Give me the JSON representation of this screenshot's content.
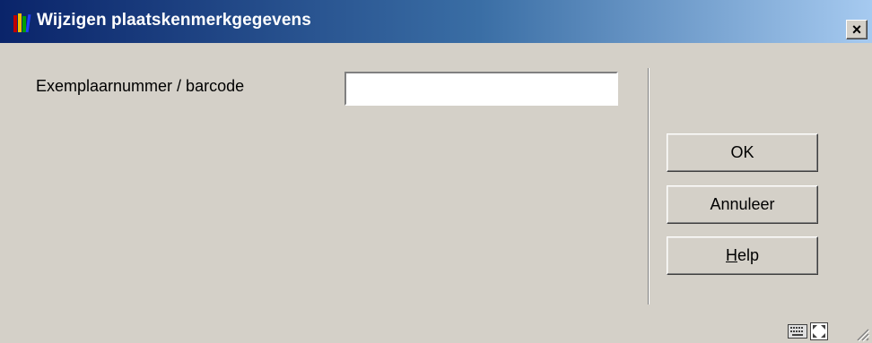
{
  "window": {
    "title": "Wijzigen plaatskenmerkgegevens",
    "close_label": "×"
  },
  "form": {
    "item_label": "Exemplaarnummer / barcode",
    "item_value": ""
  },
  "buttons": {
    "ok": "OK",
    "cancel": "Annuleer",
    "help": "Help"
  },
  "icons": {
    "app": "library-books-icon",
    "keyboard": "keyboard-icon",
    "expand": "expand-icon",
    "grip": "resize-grip-icon"
  }
}
